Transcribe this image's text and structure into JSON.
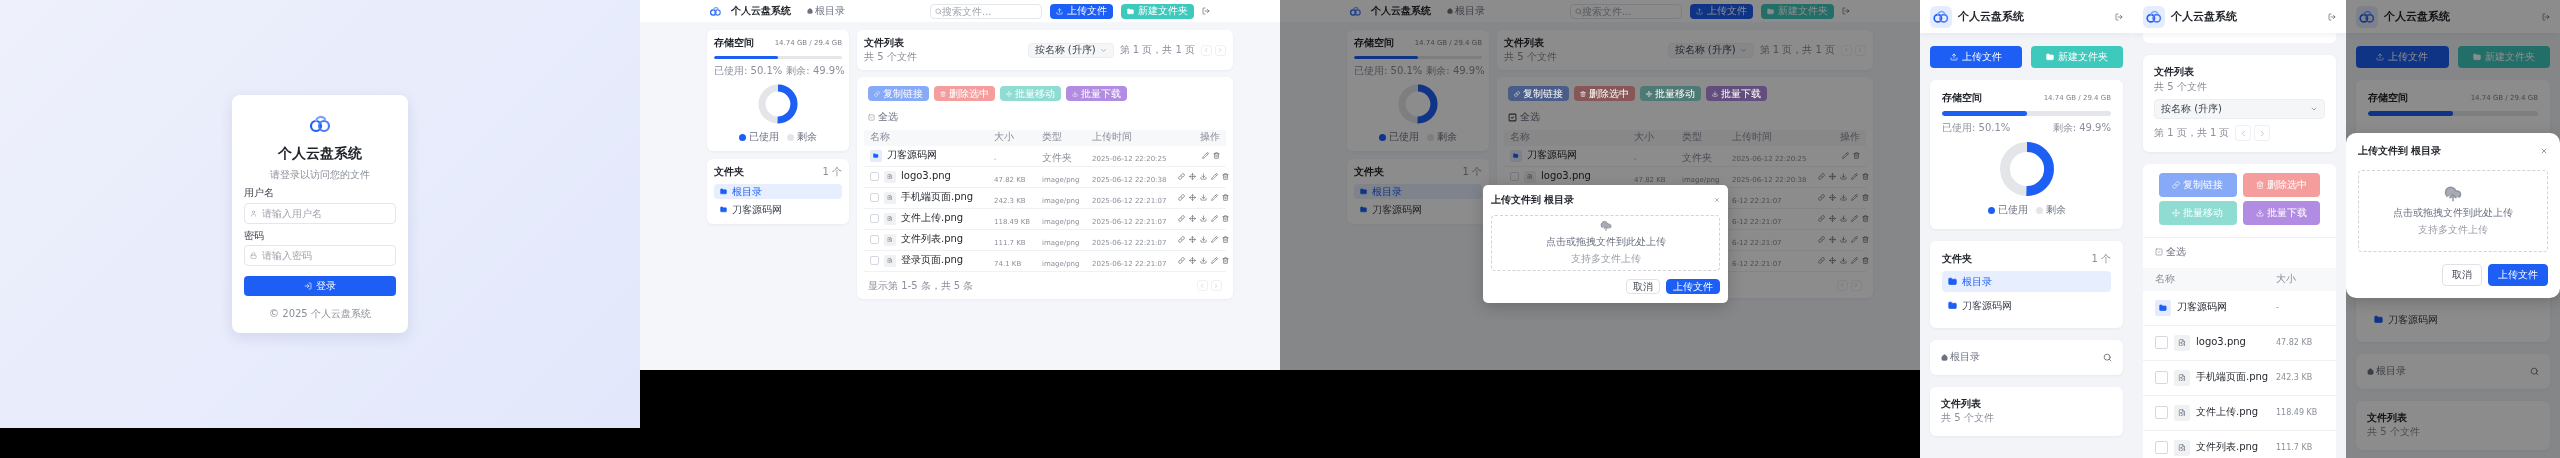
{
  "login": {
    "app_name": "个人云盘系统",
    "subtitle": "请登录以访问您的文件",
    "fields": [
      {
        "kind": "user",
        "label": "用户名",
        "placeholder": "请输入用户名"
      },
      {
        "kind": "lock",
        "label": "密码",
        "placeholder": "请输入密码"
      }
    ],
    "button": "登录",
    "footer": "© 2025 个人云盘系统"
  },
  "desktop_views": [
    {
      "header": {
        "app_name": "个人云盘系统",
        "breadcrumb": "根目录",
        "search_placeholder": "搜索文件...",
        "upload_button": "上传文件",
        "new_folder_button": "新建文件夹"
      },
      "storage": {
        "title": "存储空间",
        "usage": "14.74 GB / 29.4 GB",
        "used_label": "已使用: 50.1%",
        "free_label": "剩余: 49.9%",
        "level": 0.501,
        "legend": [
          {
            "label": "已使用",
            "color": "#1d5ff5"
          },
          {
            "label": "剩余",
            "color": "#e3e5e9"
          }
        ]
      },
      "folders": {
        "title": "文件夹",
        "count": "1 个",
        "items": [
          {
            "label": "根目录",
            "selected": true
          },
          {
            "label": "刀客源码网",
            "selected": false
          }
        ]
      },
      "file_list": {
        "title": "文件列表",
        "subtitle": "共 5 个文件",
        "sort": "按名称 (升序)",
        "page_info": "第 1 页，共 1 页"
      },
      "actions": [
        {
          "kind": "link",
          "label": "复制链接",
          "color": "#86a9f8"
        },
        {
          "kind": "delete",
          "label": "删除选中",
          "color": "#f59d9d"
        },
        {
          "kind": "move",
          "label": "批量移动",
          "color": "#8fdcd3"
        },
        {
          "kind": "download",
          "label": "批量下载",
          "color": "#b28ce2"
        }
      ],
      "select_all": {
        "label": "全选",
        "checked": true
      },
      "columns": [
        "名称",
        "大小",
        "类型",
        "上传时间",
        "操作"
      ],
      "rows": [
        {
          "kind": "folder",
          "name": "刀客源码网",
          "size": "-",
          "type": "文件夹",
          "date": "2025-06-12 22:20:25"
        },
        {
          "kind": "file",
          "checked": false,
          "name": "logo3.png",
          "size": "47.82 KB",
          "type": "image/png",
          "date": "2025-06-12 22:20:38"
        },
        {
          "kind": "file",
          "checked": false,
          "name": "手机端页面.png",
          "size": "242.3 KB",
          "type": "image/png",
          "date": "2025-06-12 22:21:07"
        },
        {
          "kind": "file",
          "checked": false,
          "name": "文件上传.png",
          "size": "118.49 KB",
          "type": "image/png",
          "date": "2025-06-12 22:21:07"
        },
        {
          "kind": "file",
          "checked": false,
          "name": "文件列表.png",
          "size": "111.7 KB",
          "type": "image/png",
          "date": "2025-06-12 22:21:07"
        },
        {
          "kind": "file",
          "checked": false,
          "name": "登录页面.png",
          "size": "74.1 KB",
          "type": "image/png",
          "date": "2025-06-12 22:21:07"
        }
      ],
      "footer": "显示第 1-5 条，共 5 条"
    },
    {
      "header": {
        "app_name": "个人云盘系统",
        "breadcrumb": "根目录",
        "search_placeholder": "搜索文件...",
        "upload_button": "上传文件",
        "new_folder_button": "新建文件夹"
      },
      "storage": {
        "title": "存储空间",
        "usage": "14.74 GB / 29.4 GB",
        "used_label": "已使用: 50.1%",
        "free_label": "剩余: 49.9%",
        "level": 0.501,
        "legend": [
          {
            "label": "已使用",
            "color": "#103487"
          },
          {
            "label": "剩余",
            "color": "#7d7e80"
          }
        ]
      },
      "folders": {
        "title": "文件夹",
        "count": "1 个",
        "items": [
          {
            "label": "根目录",
            "selected": true
          },
          {
            "label": "刀客源码网",
            "selected": false
          }
        ]
      },
      "file_list": {
        "title": "文件列表",
        "subtitle": "共 5 个文件",
        "sort": "按名称 (升序)",
        "page_info": "第 1 页，共 1 页"
      },
      "actions": [
        {
          "kind": "link",
          "label": "复制链接",
          "color": "#4a5d88"
        },
        {
          "kind": "delete",
          "label": "删除选中",
          "color": "#875656"
        },
        {
          "kind": "move",
          "label": "批量移动",
          "color": "#4f7974"
        },
        {
          "kind": "download",
          "label": "批量下载",
          "color": "#624d7c"
        }
      ],
      "select_all": {
        "label": "全选",
        "checked": true
      },
      "columns": [
        "名称",
        "大小",
        "类型",
        "上传时间",
        "操作"
      ],
      "rows": [
        {
          "kind": "folder",
          "name": "刀客源码网",
          "size": "-",
          "type": "文件夹",
          "date": "2025-06-12 22:20:25"
        },
        {
          "kind": "file",
          "checked": false,
          "name": "logo3.png",
          "size": "47.82 KB",
          "type": "image/png",
          "date": "2025-06-12 22:20:38"
        },
        {
          "kind": "file",
          "date": "6-12 22:21:07"
        },
        {
          "kind": "file",
          "date": "6-12 22:21:07"
        },
        {
          "kind": "file",
          "date": "6-12 22:21:07"
        },
        {
          "kind": "file",
          "date": "6-12 22:21:07"
        }
      ],
      "modal": {
        "title": "上传文件到 根目录",
        "drop_text": "点击或拖拽文件到此处上传",
        "hint": "支持多文件上传",
        "cancel": "取消",
        "confirm": "上传文件"
      }
    }
  ],
  "mobile_views": [
    {
      "header": {
        "app_name": "个人云盘系统"
      },
      "sections": [
        {
          "kind": "buttons",
          "upload": "上传文件",
          "new_folder": "新建文件夹"
        },
        {
          "kind": "storage",
          "title": "存储空间",
          "usage": "14.74 GB / 29.4 GB",
          "used_label": "已使用: 50.1%",
          "free_label": "剩余: 49.9%",
          "level": 0.501,
          "legend": [
            {
              "label": "已使用",
              "color": "#1d5ff5"
            },
            {
              "label": "剩余",
              "color": "#e3e5e9"
            }
          ]
        },
        {
          "kind": "folders",
          "title": "文件夹",
          "count": "1 个",
          "items": [
            {
              "label": "根目录",
              "selected": true
            },
            {
              "label": "刀客源码网",
              "selected": false
            }
          ]
        },
        {
          "kind": "breadcrumb",
          "label": "根目录"
        },
        {
          "kind": "file_list",
          "title": "文件列表",
          "subtitle": "共 5 个文件"
        }
      ]
    },
    {
      "header": {
        "app_name": "个人云盘系统"
      },
      "sections": [
        {
          "kind": "card_end"
        },
        {
          "kind": "file_list",
          "title": "文件列表",
          "subtitle": "共 5 个文件",
          "sort": "按名称 (升序)",
          "page_info": "第 1 页，共 1 页"
        },
        {
          "kind": "file_table",
          "actions": [
            {
              "kind": "link",
              "label": "复制链接",
              "color": "#86a9f8"
            },
            {
              "kind": "delete",
              "label": "删除选中",
              "color": "#f59d9d"
            },
            {
              "kind": "move",
              "label": "批量移动",
              "color": "#8fdcd3"
            },
            {
              "kind": "download",
              "label": "批量下载",
              "color": "#b28ce2"
            }
          ],
          "select_all": {
            "label": "全选",
            "checked": true
          },
          "columns": [
            "名称",
            "大小"
          ],
          "rows": [
            {
              "kind": "folder",
              "name": "刀客源码网",
              "size": "-"
            },
            {
              "kind": "file",
              "checked": false,
              "name": "logo3.png",
              "size": "47.82 KB"
            },
            {
              "kind": "file",
              "checked": false,
              "name": "手机端页面.png",
              "size": "242.3 KB"
            },
            {
              "kind": "file",
              "checked": false,
              "name": "文件上传.png",
              "size": "118.49 KB"
            },
            {
              "kind": "file",
              "checked": false,
              "name": "文件列表.png",
              "size": "111.7 KB"
            }
          ]
        }
      ]
    },
    {
      "header": {
        "app_name": "个人云盘系统"
      },
      "sections": [
        {
          "kind": "buttons",
          "upload": "上传文件",
          "new_folder": "新建文件夹"
        },
        {
          "kind": "storage",
          "title": "存储空间",
          "usage": "14.74 GB / 29.4 GB",
          "level": 0.501
        },
        {
          "kind": "folders",
          "items": [
            {
              "label": "刀客源码网",
              "selected": false
            }
          ]
        },
        {
          "kind": "breadcrumb",
          "label": "根目录"
        },
        {
          "kind": "file_list",
          "title": "文件列表",
          "subtitle": "共 5 个文件"
        }
      ],
      "modal": {
        "title": "上传文件到 根目录",
        "drop_text": "点击或拖拽文件到此处上传",
        "hint": "支持多文件上传",
        "cancel": "取消",
        "confirm": "上传文件"
      }
    }
  ]
}
